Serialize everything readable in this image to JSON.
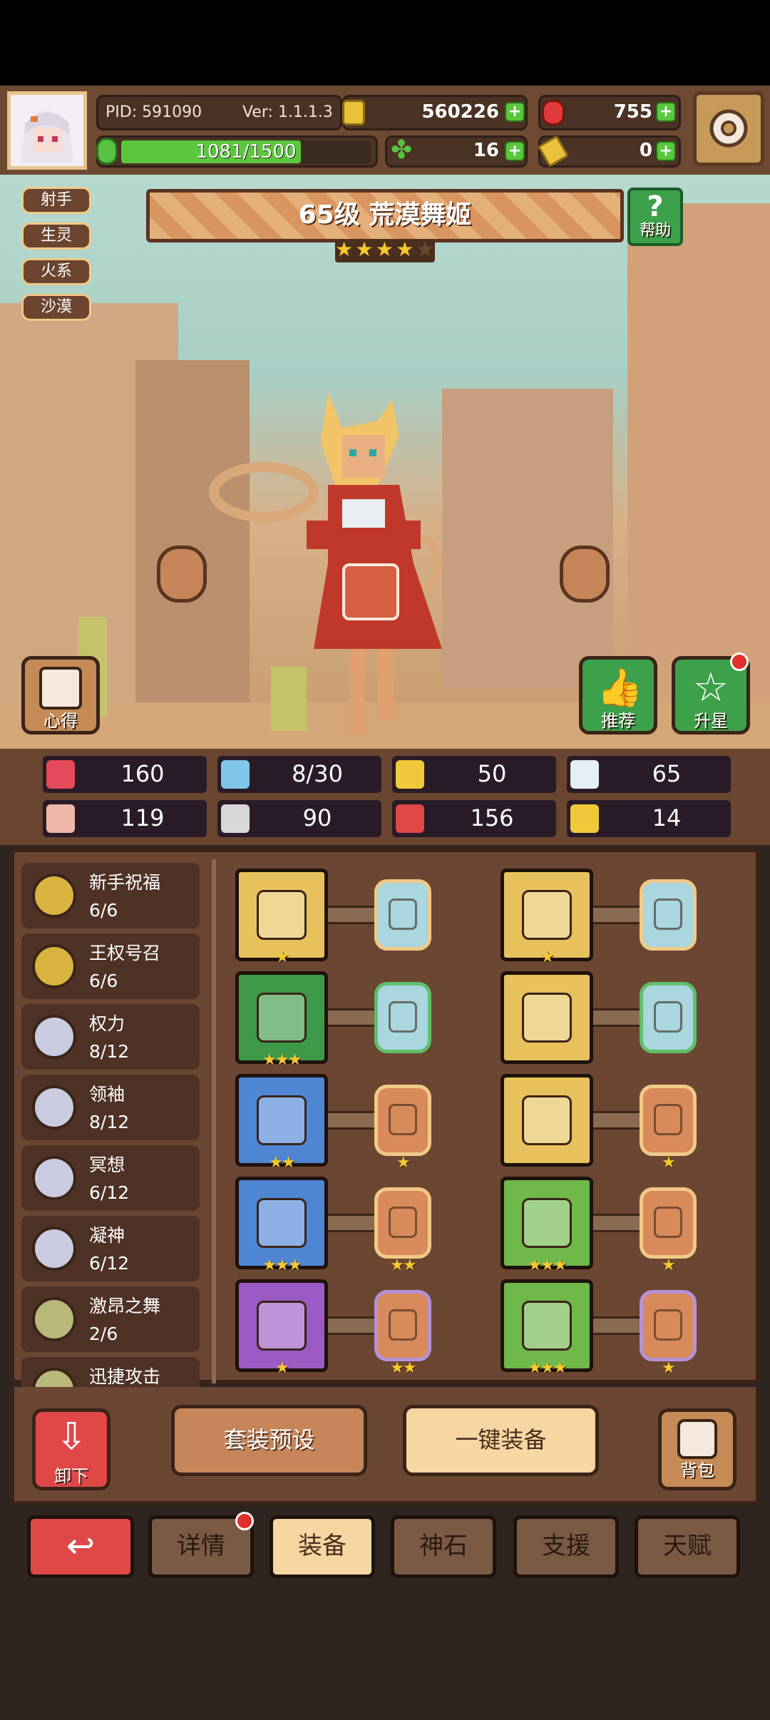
{
  "header": {
    "pid": "PID: 591090",
    "version": "Ver: 1.1.1.3",
    "gold": "560226",
    "gems": "755",
    "xp_text": "1081/1500",
    "xp_progress": 0.72,
    "clover": "16",
    "keys": "0"
  },
  "hero": {
    "title": "65级  荒漠舞姬",
    "stars": 4,
    "tags": [
      "射手",
      "生灵",
      "火系",
      "沙漠"
    ],
    "help_label": "帮助",
    "notes_label": "心得",
    "recommend_label": "推荐",
    "upstar_label": "升星"
  },
  "stats": [
    {
      "icon": "heart-icon",
      "value": "160"
    },
    {
      "icon": "water-drop-icon",
      "value": "8/30"
    },
    {
      "icon": "shield-icon",
      "value": "50"
    },
    {
      "icon": "wing-icon",
      "value": "65"
    },
    {
      "icon": "fist-icon",
      "value": "119"
    },
    {
      "icon": "book-icon",
      "value": "90"
    },
    {
      "icon": "potion-icon",
      "value": "156"
    },
    {
      "icon": "crown-icon",
      "value": "14"
    }
  ],
  "sets": [
    {
      "name": "新手祝福",
      "progress": "6/6",
      "color": "#d9b340"
    },
    {
      "name": "王权号召",
      "progress": "6/6",
      "color": "#d9b340"
    },
    {
      "name": "权力",
      "progress": "8/12",
      "color": "#c9cbe0"
    },
    {
      "name": "领袖",
      "progress": "8/12",
      "color": "#c9cbe0"
    },
    {
      "name": "冥想",
      "progress": "6/12",
      "color": "#c9cbe0"
    },
    {
      "name": "凝神",
      "progress": "6/12",
      "color": "#c9cbe0"
    },
    {
      "name": "激昂之舞",
      "progress": "2/6",
      "color": "#b8b87a"
    },
    {
      "name": "迅捷攻击",
      "progress": "",
      "color": "#b8b87a"
    }
  ],
  "equipment": {
    "left": [
      {
        "item": "scepter-icon",
        "bg": "#e7c25c",
        "stars": "★",
        "gem_bg": "#a9d6df",
        "gem_border": "#f0c987",
        "gem_stars": ""
      },
      {
        "item": "leaf-blade-icon",
        "bg": "#3e9a48",
        "stars": "★★★",
        "gem_bg": "#a9d6df",
        "gem_border": "#5fbf6a",
        "gem_stars": ""
      },
      {
        "item": "necklace-icon",
        "bg": "#4f86d4",
        "stars": "★★",
        "gem_bg": "#d98a5a",
        "gem_border": "#f0c987",
        "gem_stars": "★"
      },
      {
        "item": "amulet-icon",
        "bg": "#4f86d4",
        "stars": "★★★",
        "gem_bg": "#d98a5a",
        "gem_border": "#f0c987",
        "gem_stars": "★★"
      },
      {
        "item": "lips-icon",
        "bg": "#9b5bc4",
        "stars": "★",
        "gem_bg": "#d98a5a",
        "gem_border": "#b592d6",
        "gem_stars": "★★"
      }
    ],
    "right": [
      {
        "item": "tiara-icon",
        "bg": "#e7c25c",
        "stars": "★",
        "gem_bg": "#a9d6df",
        "gem_border": "#f0c987",
        "gem_stars": ""
      },
      {
        "item": "robe-icon",
        "bg": "#e7c25c",
        "stars": "",
        "gem_bg": "#a9d6df",
        "gem_border": "#5fbf6a",
        "gem_stars": ""
      },
      {
        "item": "ring-icon",
        "bg": "#e7c25c",
        "stars": "",
        "gem_bg": "#d98a5a",
        "gem_border": "#f0c987",
        "gem_stars": "★"
      },
      {
        "item": "belt-icon",
        "bg": "#6fb84a",
        "stars": "★★★",
        "gem_bg": "#d98a5a",
        "gem_border": "#f0c987",
        "gem_stars": "★"
      },
      {
        "item": "boots-icon",
        "bg": "#6fb84a",
        "stars": "★★★",
        "gem_bg": "#d98a5a",
        "gem_border": "#b592d6",
        "gem_stars": "★"
      }
    ]
  },
  "actions": {
    "unequip": "卸下",
    "preset": "套装预设",
    "equip_all": "一键装备",
    "backpack": "背包"
  },
  "tabs": [
    "详情",
    "装备",
    "神石",
    "支援",
    "天赋"
  ]
}
